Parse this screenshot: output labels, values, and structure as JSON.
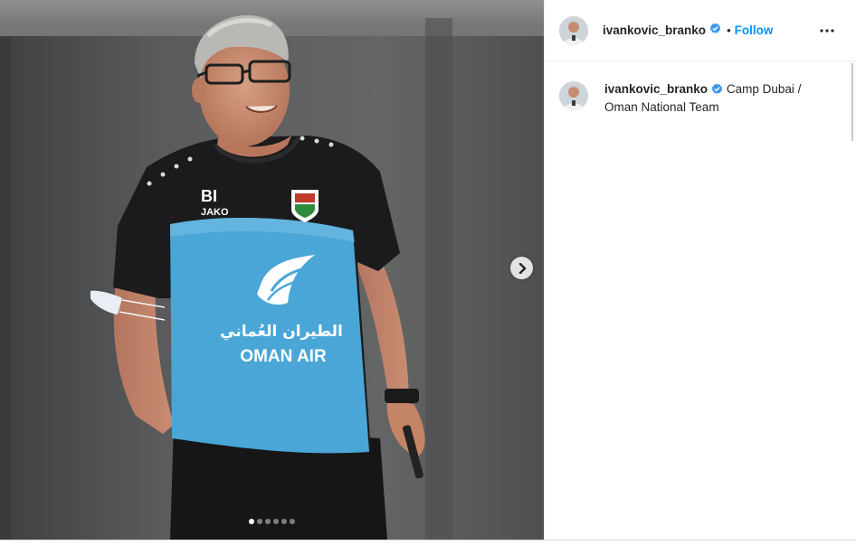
{
  "post": {
    "username": "ivankovic_branko",
    "follow_label": "Follow",
    "bullet": "•",
    "caption": "Camp Dubai / Oman National Team",
    "carousel": {
      "slide_count": 6,
      "active_index": 0
    }
  },
  "photo": {
    "subject": "coach-smiling-in-training-shirt",
    "shirt_initials": "BI",
    "shirt_kit_brand": "JAKO",
    "sponsor_arabic": "الطيران العُماني",
    "sponsor_latin": "OMAN AIR"
  },
  "icons": {
    "verified": "verified-badge-icon",
    "more": "more-options-icon",
    "next": "chevron-right-icon"
  },
  "colors": {
    "accent": "#0095f6",
    "shirt_black": "#1b1b1d",
    "shirt_blue": "#4aa6d6",
    "background_grey": "#5b5b5b"
  }
}
